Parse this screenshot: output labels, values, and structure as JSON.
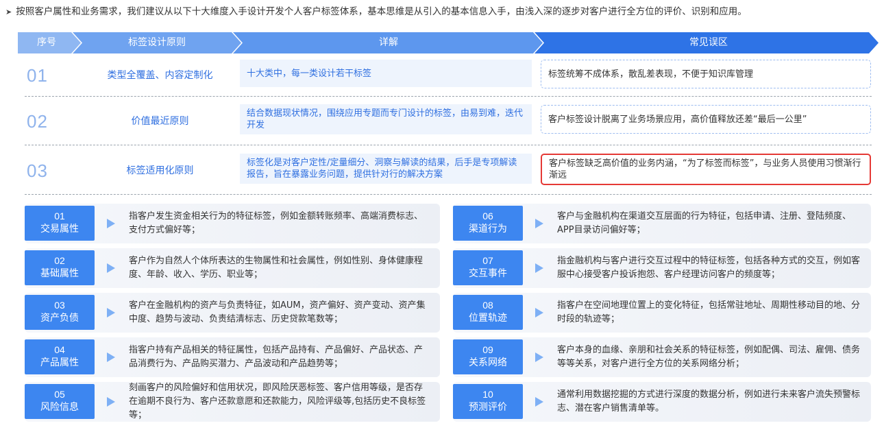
{
  "intro": {
    "bullet": "➤",
    "text": "按照客户属性和业务需求，我们建议从以下十大维度入手设计开发个人客户标签体系，基本思维是从引入的基本信息入手，由浅入深的逐步对客户进行全方位的评价、识别和应用。"
  },
  "header": {
    "col_index": "序号",
    "col_principle": "标签设计原则",
    "col_detail": "详解",
    "col_pitfall": "常见误区",
    "colors": {
      "light": "#8fb7f2",
      "mid": "#5d97ee",
      "dark": "#2e73e6"
    }
  },
  "principles": [
    {
      "num": "01",
      "name": "类型全覆盖、内容定制化",
      "detail": "十大类中，每一类设计若干标签",
      "pitfall": "标签统筹不成体系，散乱差表现，不便于知识库管理"
    },
    {
      "num": "02",
      "name": "价值最近原则",
      "detail": "结合数据现状情况，围绕应用专题而专门设计的标签，由易到难，迭代开发",
      "pitfall": "客户标签设计脱离了业务场景应用，高价值释放还差“最后一公里”"
    },
    {
      "num": "03",
      "name": "标签适用化原则",
      "detail": "标签化是对客户定性/定量细分、洞察与解读的结果，后手是专项解读报告，旨在暴露业务问题，提供针对行的解决方案",
      "pitfall": "客户标签缺乏高价值的业务内涵，“为了标签而标签”，与业务人员使用习惯渐行渐远",
      "highlight": true
    }
  ],
  "dimensions": [
    {
      "num": "01",
      "label": "交易属性",
      "desc": "指客户发生资金相关行为的特征标签，例如金额转账频率、高端消费标志、支付方式偏好等；"
    },
    {
      "num": "02",
      "label": "基础属性",
      "desc": "客户作为自然人个体所表达的生物属性和社会属性，例如性别、身体健康程度、年龄、收入、学历、职业等；"
    },
    {
      "num": "03",
      "label": "资产负债",
      "desc": "客户在金融机构的资产与负责特征，如AUM，资产偏好、资产变动、资产集中度、趋势与波动、负责结清标志、历史贷款笔数等；"
    },
    {
      "num": "04",
      "label": "产品属性",
      "desc": "指客户持有产品相关的特征属性，包括产品持有、产品偏好、产品状态、产品消费行为、产品购买潜力、产品波动和产品趋势等；"
    },
    {
      "num": "05",
      "label": "风险信息",
      "desc": "刻画客户的风险偏好和信用状况，即风险厌恶标签、客户信用等级，是否存在逾期不良行为、客户还款意愿和还款能力，风险评级等,包括历史不良标签等；"
    },
    {
      "num": "06",
      "label": "渠道行为",
      "desc": "客户与金融机构在渠道交互层面的行为特征，包括申请、注册、登陆频度、APP目录访问偏好等；"
    },
    {
      "num": "07",
      "label": "交互事件",
      "desc": "指金融机构与客户进行交互过程中的特征标签，包括各种方式的交互，例如客服中心接受客户投诉抱怨、客户经理访问客户的频度等；"
    },
    {
      "num": "08",
      "label": "位置轨迹",
      "desc": "指客户在空间地理位置上的变化特征，包括常驻地址、周期性移动目的地、分时段的轨迹等；"
    },
    {
      "num": "09",
      "label": "关系网络",
      "desc": "客户本身的血缘、亲朋和社会关系的特征标签，例如配偶、司法、雇佣、债务等等关系，对客户进行全方位的关系网络分析；"
    },
    {
      "num": "10",
      "label": "预测评价",
      "desc": "通常利用数据挖掘的方式进行深度的数据分析，例如进行未来客户流失预警标志、潜在客户销售清单等。"
    }
  ],
  "icons": {
    "badge_arrow": "arrow-right-icon",
    "intro_bullet": "bullet-arrow-icon"
  }
}
